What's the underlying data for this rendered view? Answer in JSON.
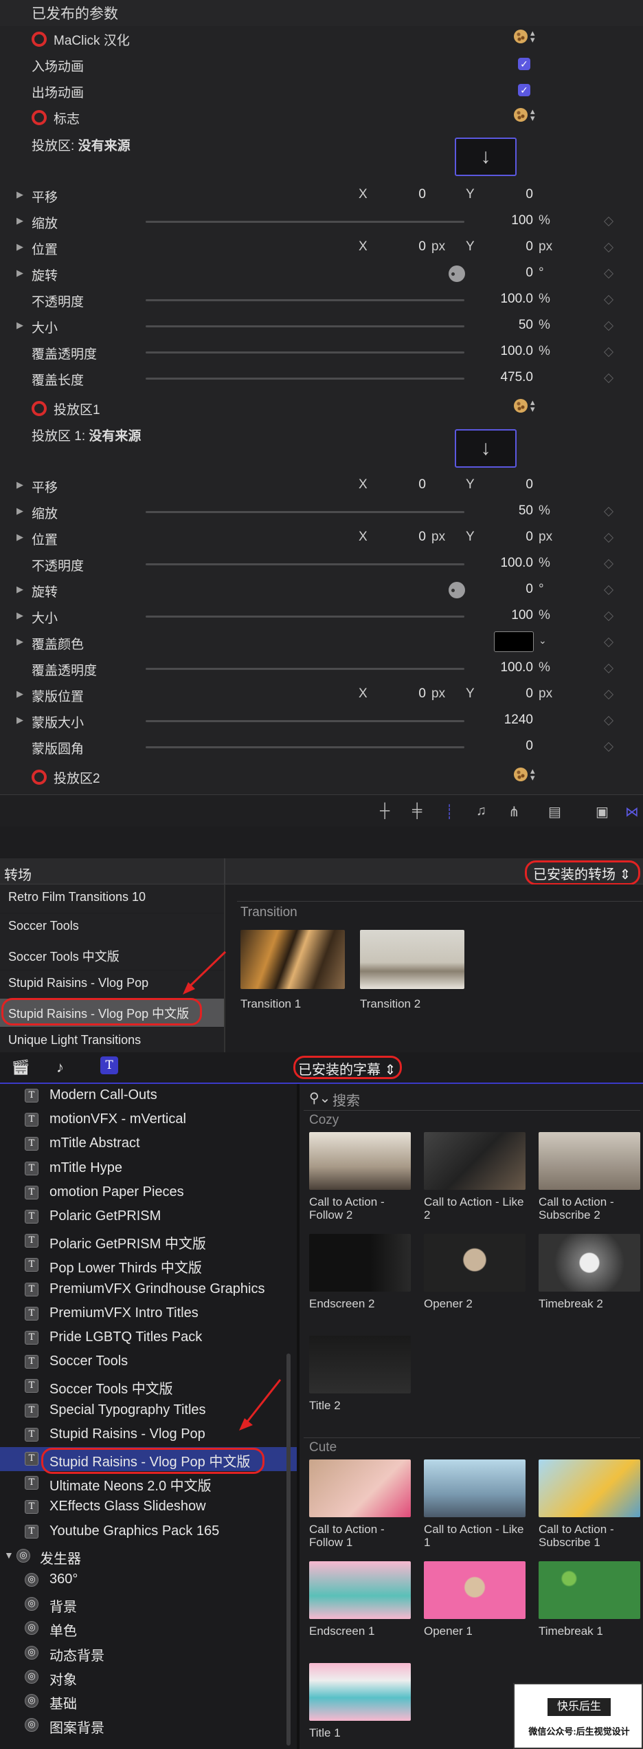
{
  "inspector": {
    "section_title": "已发布的参数",
    "maclick_label": "MaClick 汉化",
    "in_anim": "入场动画",
    "out_anim": "出场动画",
    "logo_label": "标志",
    "drop_zone": "投放区:",
    "drop_zone_value": "没有来源",
    "drop_arrow": "↓",
    "rows_a": [
      {
        "label": "平移",
        "x": "0",
        "y": "0"
      },
      {
        "label": "缩放",
        "value": "100",
        "unit": "%",
        "slider": 0.16
      },
      {
        "label": "位置",
        "x": "0",
        "xu": "px",
        "y": "0",
        "yu": "px"
      },
      {
        "label": "旋转",
        "value": "0",
        "unit": "°"
      },
      {
        "label": "不透明度",
        "value": "100.0",
        "unit": "%",
        "slider": 1.0
      },
      {
        "label": "大小",
        "value": "50",
        "unit": "%",
        "slider": 0.08
      },
      {
        "label": "覆盖透明度",
        "value": "100.0",
        "unit": "%",
        "slider": 1.0
      },
      {
        "label": "覆盖长度",
        "value": "475.0",
        "slider": 0.3
      }
    ],
    "dropzone1": "投放区1",
    "drop_zone1": "投放区 1:",
    "drop_zone1_value": "没有来源",
    "rows_b": [
      {
        "label": "平移",
        "x": "0",
        "y": "0"
      },
      {
        "label": "缩放",
        "value": "50",
        "unit": "%",
        "slider": 0.08
      },
      {
        "label": "位置",
        "x": "0",
        "xu": "px",
        "y": "0",
        "yu": "px"
      },
      {
        "label": "不透明度",
        "value": "100.0",
        "unit": "%",
        "slider": 1.0
      },
      {
        "label": "旋转",
        "value": "0",
        "unit": "°"
      },
      {
        "label": "大小",
        "value": "100",
        "unit": "%",
        "slider": 0.16
      },
      {
        "label": "覆盖颜色"
      },
      {
        "label": "覆盖透明度",
        "value": "100.0",
        "unit": "%",
        "slider": 1.0
      },
      {
        "label": "蒙版位置",
        "x": "0",
        "xu": "px",
        "y": "0",
        "yu": "px"
      },
      {
        "label": "蒙版大小",
        "value": "1240",
        "slider": 1.0
      },
      {
        "label": "蒙版圆角",
        "value": "0",
        "slider": 0.0
      }
    ],
    "dropzone2": "投放区2",
    "x_label": "X",
    "y_label": "Y"
  },
  "transitions": {
    "header": "转场",
    "installed": "已安装的转场",
    "items": [
      "Retro Film Transitions 10",
      "Soccer Tools",
      "Soccer Tools 中文版",
      "Stupid Raisins - Vlog Pop",
      "Stupid Raisins - Vlog Pop 中文版",
      "Unique Light Transitions"
    ],
    "selected_index": 4,
    "section": "Transition",
    "thumbs": [
      "Transition 1",
      "Transition 2"
    ]
  },
  "titles": {
    "installed": "已安装的字幕",
    "search_placeholder": "搜索",
    "items": [
      "Modern Call-Outs",
      "motionVFX - mVertical",
      "mTitle Abstract",
      "mTitle Hype",
      "omotion Paper Pieces",
      "Polaric GetPRISM",
      "Polaric GetPRISM 中文版",
      "Pop Lower Thirds 中文版",
      "PremiumVFX Grindhouse Graphics",
      "PremiumVFX Intro Titles",
      "Pride LGBTQ Titles Pack",
      "Soccer Tools",
      "Soccer Tools 中文版",
      "Special Typography Titles",
      "Stupid Raisins - Vlog Pop",
      "Stupid Raisins - Vlog Pop 中文版",
      "Ultimate Neons 2.0 中文版",
      "XEffects Glass Slideshow",
      "Youtube Graphics Pack 165"
    ],
    "selected_index": 15,
    "generator_header": "发生器",
    "generators": [
      "360°",
      "背景",
      "单色",
      "动态背景",
      "对象",
      "基础",
      "图案背景"
    ],
    "cozy": "Cozy",
    "cozy_items": [
      "Call to Action - Follow 2",
      "Call to Action - Like 2",
      "Call to Action - Subscribe 2",
      "Endscreen 2",
      "Opener 2",
      "Timebreak 2",
      "Title 2"
    ],
    "cute": "Cute",
    "cute_items": [
      "Call to Action - Follow 1",
      "Call to Action - Like 1",
      "Call to Action - Subscribe 1",
      "Endscreen 1",
      "Opener 1",
      "Timebreak 1",
      "Title 1"
    ]
  },
  "watermark": {
    "title": "快乐后生",
    "sub": "微信公众号:后生视觉设计"
  },
  "colors": {
    "accent": "#5b58e0",
    "highlight": "#e22222",
    "selection": "#2c3a8a"
  }
}
